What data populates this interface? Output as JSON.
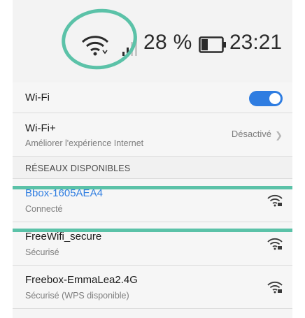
{
  "status_bar": {
    "battery_percent": "28 %",
    "time": "23:21",
    "wifi_icon": "wifi-icon",
    "signal_icon": "cell-signal-icon",
    "battery_icon": "battery-icon"
  },
  "settings": {
    "wifi": {
      "label": "Wi-Fi",
      "enabled": true
    },
    "wifi_plus": {
      "label": "Wi-Fi+",
      "subtitle": "Améliorer l'expérience Internet",
      "status": "Désactivé"
    }
  },
  "section_header": "RÉSEAUX DISPONIBLES",
  "networks": [
    {
      "name": "Bbox-1605AEA4",
      "status": "Connecté",
      "icon": "wifi-locked-icon"
    },
    {
      "name": "FreeWifi_secure",
      "status": "Sécurisé",
      "icon": "wifi-locked-icon"
    },
    {
      "name": "Freebox-EmmaLea2.4G",
      "status": "Sécurisé (WPS disponible)",
      "icon": "wifi-locked-icon"
    }
  ],
  "colors": {
    "accent_blue": "#2f7de1",
    "highlight_green": "#5bc2a8"
  }
}
